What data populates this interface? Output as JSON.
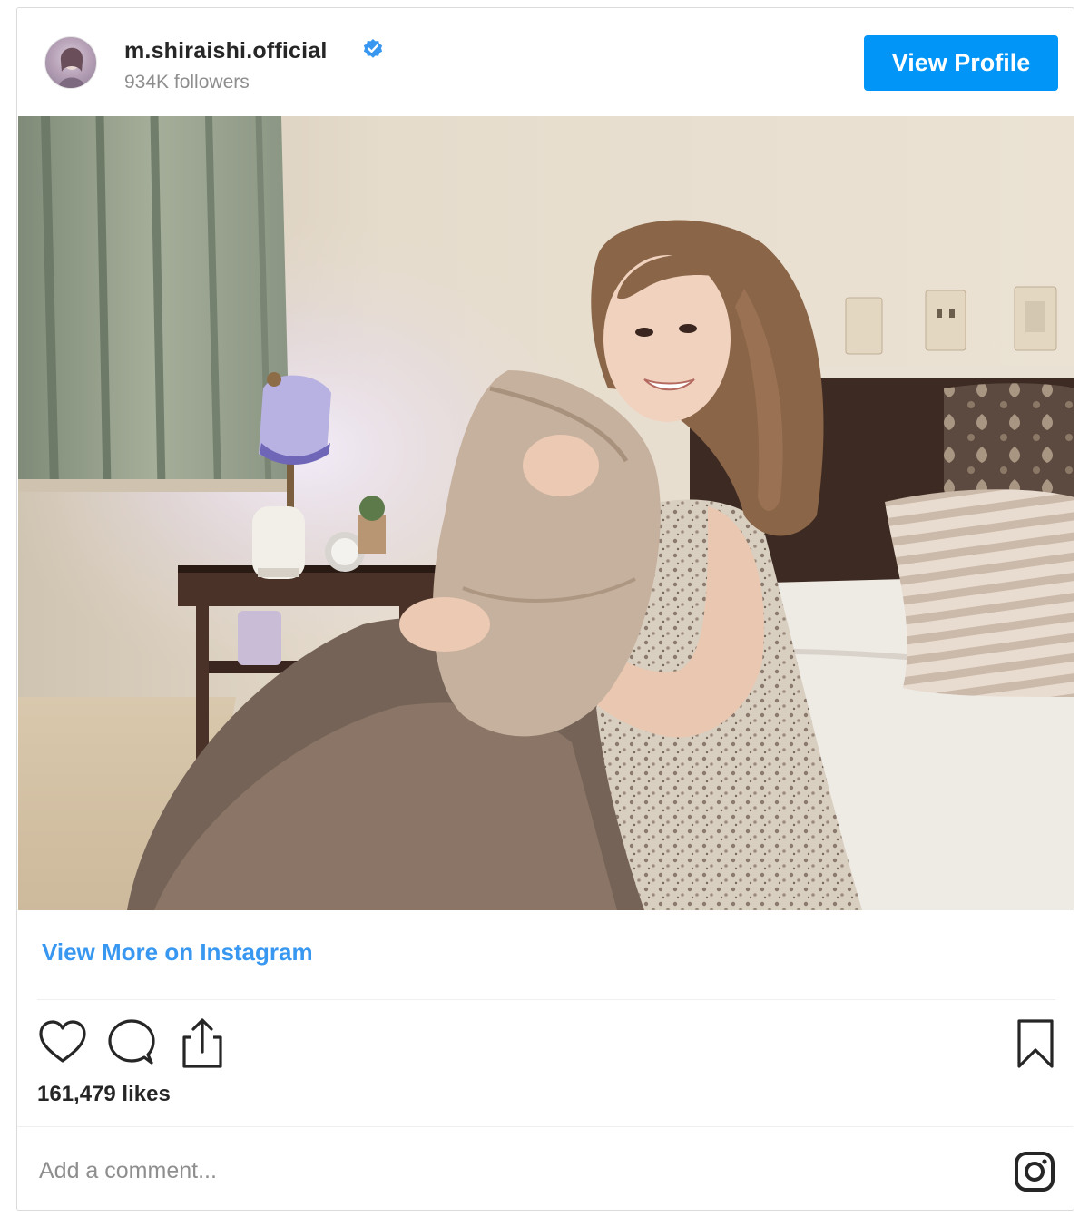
{
  "post": {
    "username": "m.shiraishi.official",
    "followers": "934K followers",
    "view_profile_label": "View Profile",
    "view_more_label": "View More on Instagram",
    "likes": "161,479 likes",
    "comment_placeholder": "Add a comment..."
  },
  "icons": {
    "verified": "verified-badge-icon",
    "like": "heart-icon",
    "comment": "comment-bubble-icon",
    "share": "share-icon",
    "save": "bookmark-icon",
    "logo": "instagram-logo-icon"
  },
  "colors": {
    "accent": "#0095f6",
    "link": "#3897f0",
    "muted": "#8e8e8e",
    "text": "#262626",
    "verified": "#3897f0"
  }
}
